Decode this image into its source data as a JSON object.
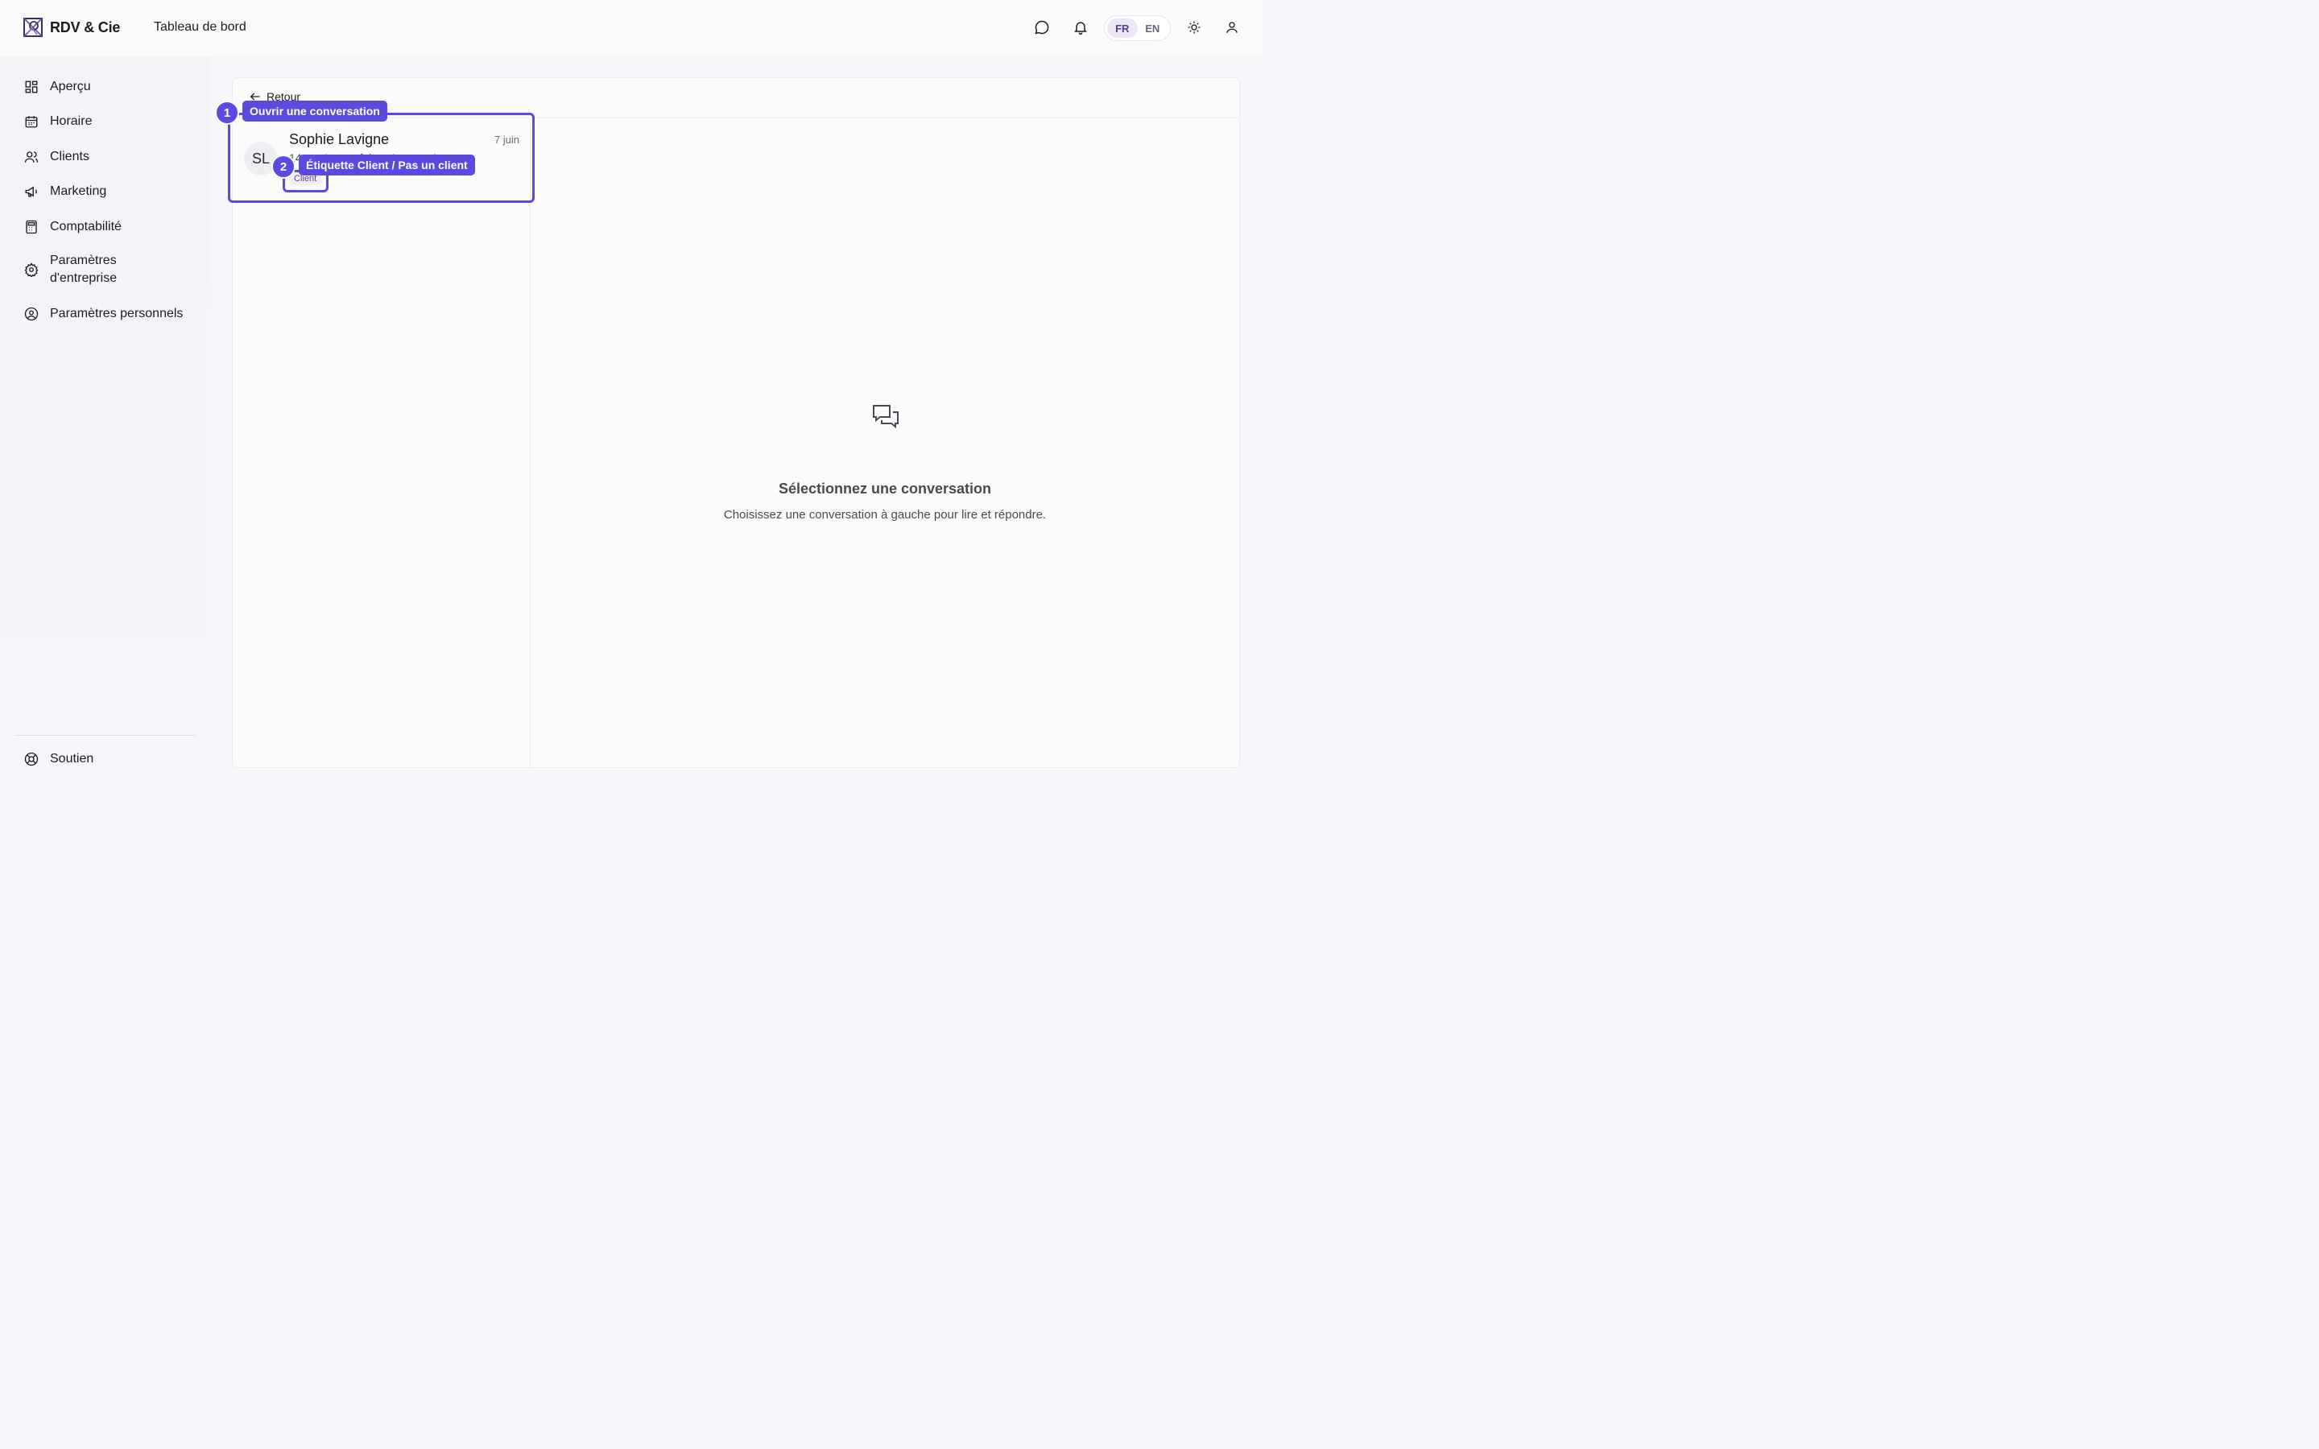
{
  "app": {
    "name": "RDV & Cie",
    "page_title": "Tableau de bord"
  },
  "header": {
    "icons": [
      "chat-icon",
      "bell-icon",
      "sun-icon",
      "user-icon"
    ],
    "languages": [
      {
        "code": "FR",
        "active": true
      },
      {
        "code": "EN",
        "active": false
      }
    ]
  },
  "sidebar": {
    "items": [
      {
        "label": "Aperçu",
        "icon": "grid-icon"
      },
      {
        "label": "Horaire",
        "icon": "calendar-icon"
      },
      {
        "label": "Clients",
        "icon": "users-icon"
      },
      {
        "label": "Marketing",
        "icon": "megaphone-icon"
      },
      {
        "label": "Comptabilité",
        "icon": "calculator-icon"
      },
      {
        "label": "Paramètres d'entreprise",
        "icon": "gear-icon"
      },
      {
        "label": "Paramètres personnels",
        "icon": "user-circle-icon"
      }
    ],
    "footer": {
      "label": "Soutien",
      "icon": "lifebuoy-icon"
    }
  },
  "main": {
    "back_label": "Retour",
    "conversation": {
      "initials": "SL",
      "name": "Sophie Lavigne",
      "date": "7 juin",
      "preview": "14 … c'est … fait … ! … … p!",
      "tag": "Client"
    },
    "empty_state": {
      "title": "Sélectionnez une conversation",
      "subtitle": "Choisissez une conversation à gauche pour lire et répondre."
    }
  },
  "tour": [
    {
      "number": "1",
      "label": "Ouvrir une conversation"
    },
    {
      "number": "2",
      "label": "Étiquette Client / Pas un client"
    }
  ],
  "colors": {
    "accent": "#5b4ae0",
    "brand_purple": "#5a3e8c"
  }
}
